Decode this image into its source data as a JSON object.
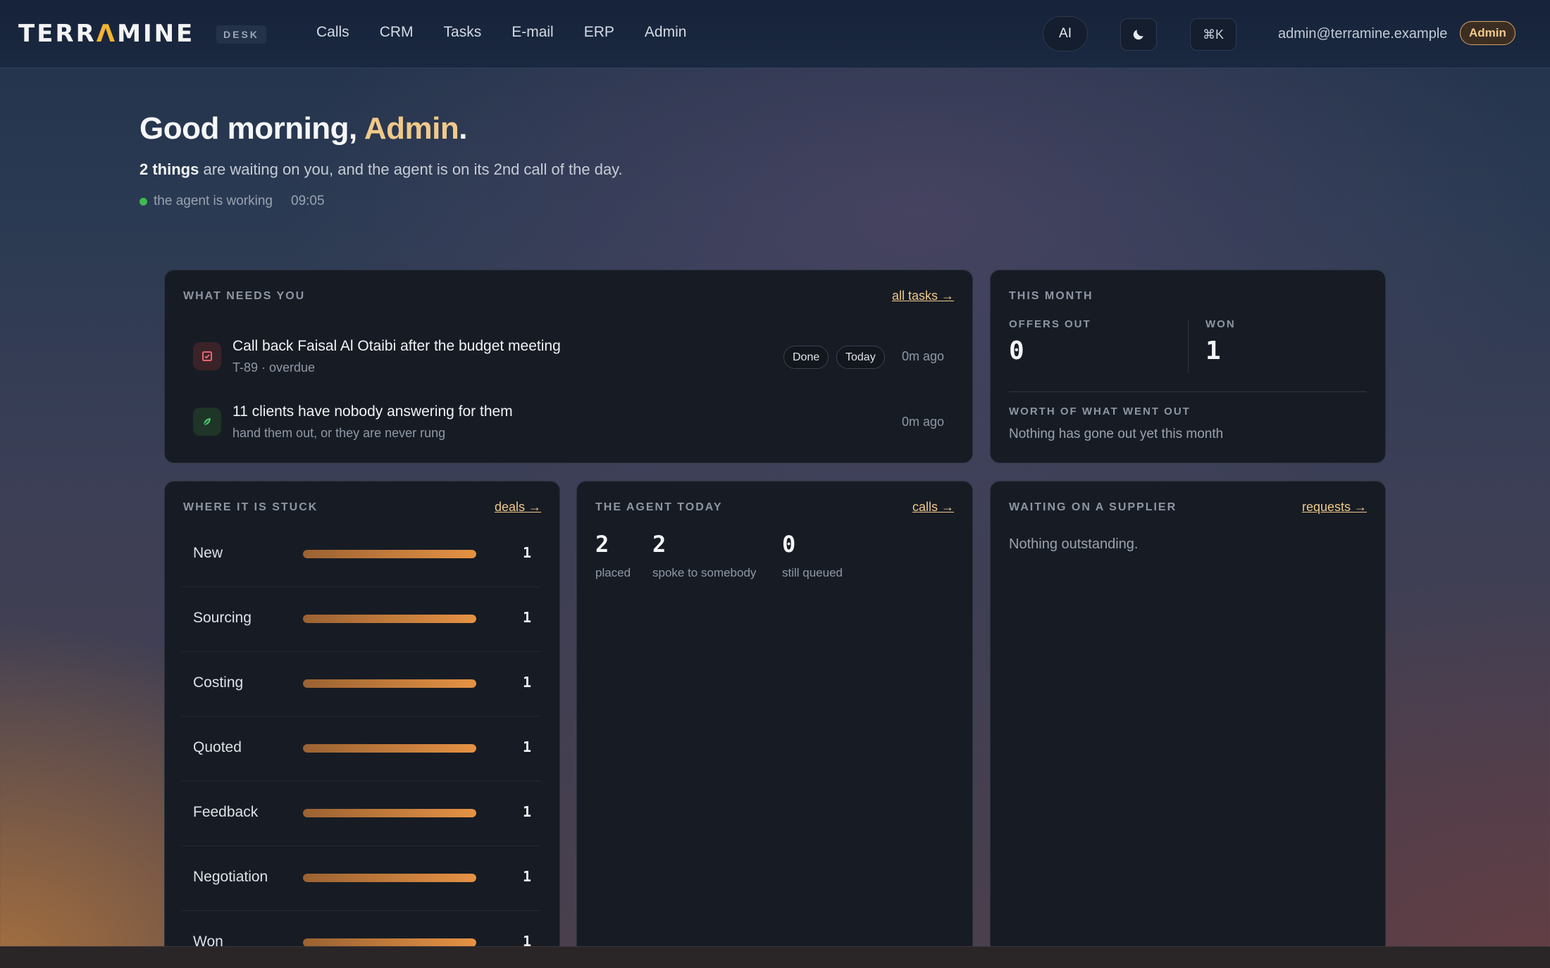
{
  "app": {
    "logo_pre": "TERR",
    "logo_accent": "Λ",
    "logo_post": "MINE",
    "product_tag": "DESK",
    "accent_color": "#f0c98a"
  },
  "nav": [
    "Calls",
    "CRM",
    "Tasks",
    "E-mail",
    "ERP",
    "Admin"
  ],
  "topbar": {
    "ai_label": "AI",
    "theme_icon": "moon-icon",
    "command_label": "⌘K",
    "user_email": "admin@terramine.example",
    "role": "Admin"
  },
  "greeting": {
    "prefix": "Good morning, ",
    "name": "Admin",
    "suffix": ".",
    "summary_bold": "2 things",
    "summary_rest": " are waiting on you, and the agent is on its 2nd call of the day.",
    "status": "the agent is working",
    "time": "09:05"
  },
  "needs_you": {
    "title": "WHAT NEEDS YOU",
    "link": "all tasks →",
    "items": [
      {
        "icon": "checkbox-icon",
        "title": "Call back Faisal Al Otaibi after the budget meeting",
        "sub": "T-89 · overdue",
        "chips": [
          "Done",
          "Today"
        ],
        "ago": "0m ago"
      },
      {
        "icon": "leaf-icon",
        "title": "11 clients have nobody answering for them",
        "sub": "hand them out, or they are never rung",
        "ago": "0m ago"
      }
    ]
  },
  "this_month": {
    "title": "THIS MONTH",
    "offers_label": "OFFERS OUT",
    "offers_value": "0",
    "won_label": "WON",
    "won_value": "1",
    "worth_label": "WORTH OF WHAT WENT OUT",
    "worth_text": "Nothing has gone out yet this month"
  },
  "stuck": {
    "title": "WHERE IT IS STUCK",
    "link": "deals →",
    "stages": [
      {
        "label": "New",
        "count": "1",
        "fill": 1.0
      },
      {
        "label": "Sourcing",
        "count": "1",
        "fill": 1.0
      },
      {
        "label": "Costing",
        "count": "1",
        "fill": 1.0
      },
      {
        "label": "Quoted",
        "count": "1",
        "fill": 1.0
      },
      {
        "label": "Feedback",
        "count": "1",
        "fill": 1.0
      },
      {
        "label": "Negotiation",
        "count": "1",
        "fill": 1.0
      },
      {
        "label": "Won",
        "count": "1",
        "fill": 1.0
      }
    ]
  },
  "agent_today": {
    "title": "THE AGENT TODAY",
    "link": "calls →",
    "stats": [
      {
        "value": "2",
        "label": "placed"
      },
      {
        "value": "2",
        "label": "spoke to somebody"
      },
      {
        "value": "0",
        "label": "still queued"
      }
    ]
  },
  "supplier": {
    "title": "WAITING ON A SUPPLIER",
    "link": "requests →",
    "empty": "Nothing outstanding."
  }
}
